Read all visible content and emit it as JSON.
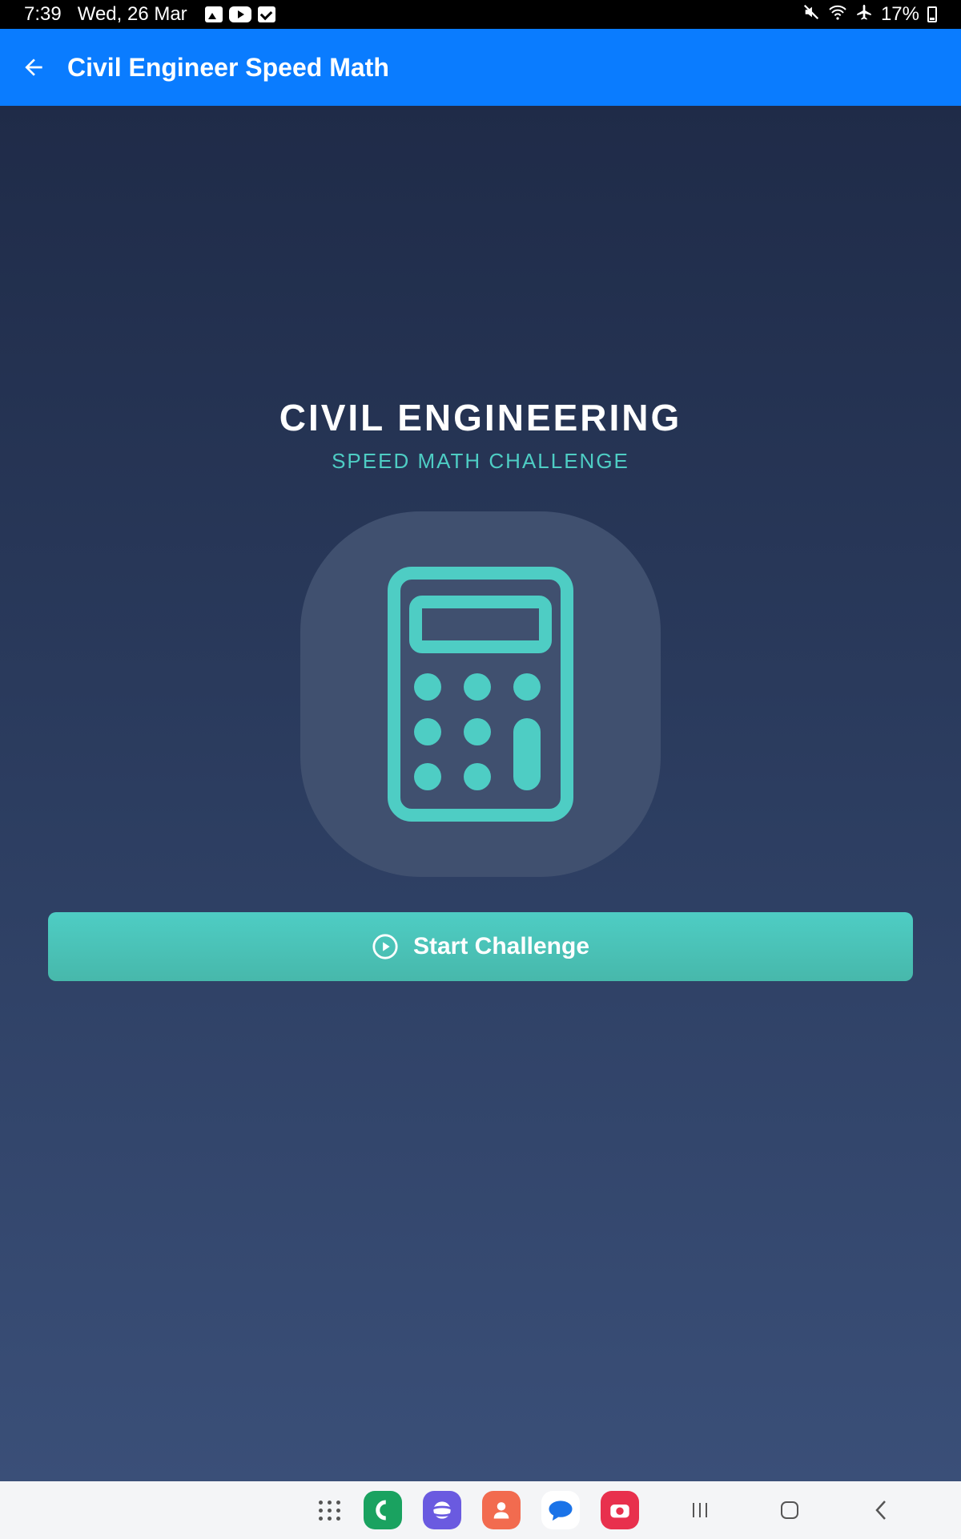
{
  "status_bar": {
    "time": "7:39",
    "date": "Wed, 26 Mar",
    "battery": "17%",
    "icons": [
      "gallery-icon",
      "youtube-icon",
      "check-icon",
      "mute-icon",
      "wifi-icon",
      "airplane-icon",
      "battery-icon"
    ]
  },
  "app_bar": {
    "title": "Civil Engineer Speed Math",
    "background": "#0a7cff"
  },
  "hero": {
    "title": "CIVIL ENGINEERING",
    "subtitle": "SPEED MATH CHALLENGE",
    "icon": "calculator-icon",
    "accent": "#4ecdc4"
  },
  "actions": {
    "start_label": "Start Challenge",
    "start_icon": "play-circle-icon"
  },
  "nav_bar": {
    "apps": [
      "apps-grid-icon",
      "phone-app-icon",
      "browser-app-icon",
      "contacts-app-icon",
      "messages-app-icon",
      "camera-app-icon"
    ],
    "buttons": [
      "recents-button",
      "home-button",
      "back-button"
    ]
  }
}
